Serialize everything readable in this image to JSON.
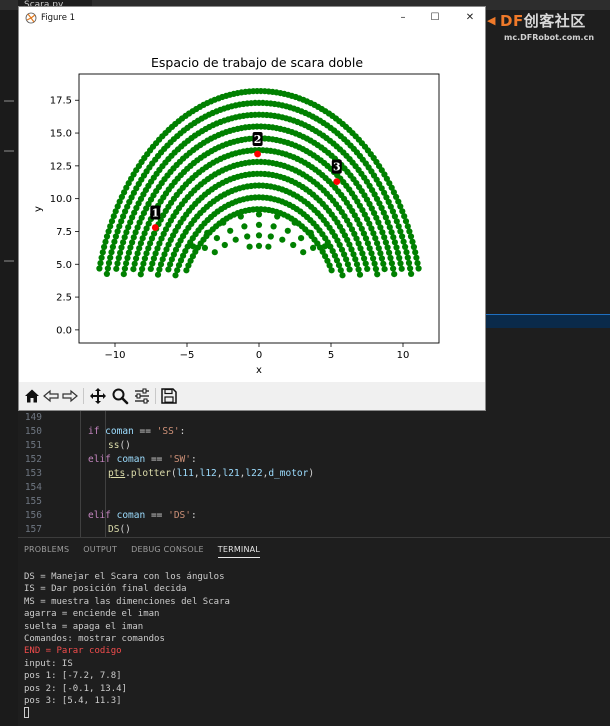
{
  "vscode": {
    "tab_label": "Scara.py",
    "code_lines": [
      {
        "n": "149",
        "tokens": []
      },
      {
        "n": "150",
        "tokens": [
          {
            "t": "if ",
            "c": "kw"
          },
          {
            "t": "coman",
            "c": "var"
          },
          {
            "t": " == ",
            "c": "op"
          },
          {
            "t": "'SS'",
            "c": "str"
          },
          {
            "t": ":",
            "c": "op"
          }
        ],
        "indent": 1
      },
      {
        "n": "151",
        "tokens": [
          {
            "t": "ss",
            "c": "fn"
          },
          {
            "t": "()",
            "c": "op"
          }
        ],
        "indent": 2
      },
      {
        "n": "152",
        "tokens": [
          {
            "t": "elif ",
            "c": "kw"
          },
          {
            "t": "coman",
            "c": "var"
          },
          {
            "t": " == ",
            "c": "op"
          },
          {
            "t": "'SW'",
            "c": "str"
          },
          {
            "t": ":",
            "c": "op"
          }
        ],
        "indent": 1
      },
      {
        "n": "153",
        "tokens": [
          {
            "t": "pts",
            "c": "fn"
          },
          {
            "t": ".",
            "c": "op"
          },
          {
            "t": "plotter",
            "c": "fn"
          },
          {
            "t": "(",
            "c": "op"
          },
          {
            "t": "l11",
            "c": "var"
          },
          {
            "t": ",",
            "c": "op"
          },
          {
            "t": "l12",
            "c": "var"
          },
          {
            "t": ",",
            "c": "op"
          },
          {
            "t": "l21",
            "c": "var"
          },
          {
            "t": ",",
            "c": "op"
          },
          {
            "t": "l22",
            "c": "var"
          },
          {
            "t": ",",
            "c": "op"
          },
          {
            "t": "d_motor",
            "c": "var"
          },
          {
            "t": ")",
            "c": "op"
          }
        ],
        "indent": 2
      },
      {
        "n": "154",
        "tokens": []
      },
      {
        "n": "155",
        "tokens": []
      },
      {
        "n": "156",
        "tokens": [
          {
            "t": "elif ",
            "c": "kw"
          },
          {
            "t": "coman",
            "c": "var"
          },
          {
            "t": " == ",
            "c": "op"
          },
          {
            "t": "'DS'",
            "c": "str"
          },
          {
            "t": ":",
            "c": "op"
          }
        ],
        "indent": 1
      },
      {
        "n": "157",
        "tokens": [
          {
            "t": "DS",
            "c": "fn"
          },
          {
            "t": "()",
            "c": "op"
          }
        ],
        "indent": 2
      }
    ],
    "panel_tabs": [
      "PROBLEMS",
      "OUTPUT",
      "DEBUG CONSOLE",
      "TERMINAL"
    ],
    "active_tab": "TERMINAL",
    "terminal_lines": [
      {
        "text": "DS = Manejar el Scara con los ángulos"
      },
      {
        "text": "IS = Dar posición final decida"
      },
      {
        "text": "MS = muestra las dimenciones del Scara"
      },
      {
        "text": "agarra = enciende el iman"
      },
      {
        "text": "suelta = apaga el iman"
      },
      {
        "text": "Comandos: mostrar comandos"
      },
      {
        "text": "END = Parar codigo",
        "red": true
      },
      {
        "text": "input: IS"
      },
      {
        "text": "pos 1: [-7.2, 7.8]"
      },
      {
        "text": "pos 2: [-0.1, 13.4]"
      },
      {
        "text": "pos 3: [5.4, 11.3]"
      }
    ]
  },
  "watermark": {
    "logo_df": "DF",
    "logo_rest": "创客社区",
    "site": "mc.DFRobot.com.cn"
  },
  "figure_window": {
    "title": "Figure 1",
    "toolbar_icons": [
      "home-icon",
      "back-icon",
      "forward-icon",
      "pan-icon",
      "zoom-icon",
      "configure-icon",
      "save-icon"
    ]
  },
  "chart_data": {
    "type": "scatter",
    "title": "Espacio de trabajo de scara doble",
    "xlabel": "x",
    "ylabel": "y",
    "xlim": [
      -12.5,
      12.5
    ],
    "ylim": [
      -1,
      19.5
    ],
    "xticks": [
      -10,
      -5,
      0,
      5,
      10
    ],
    "yticks": [
      0.0,
      2.5,
      5.0,
      7.5,
      10.0,
      12.5,
      15.0,
      17.5
    ],
    "grid": false,
    "workspace_color": "#008000",
    "workspace": {
      "outer_radius": 18.2,
      "inner_radius": 9.2,
      "center": [
        0,
        0
      ],
      "lower_boundary_y": 4.4,
      "x_extent": [
        -11.5,
        11.5
      ]
    },
    "points": [
      {
        "label": "1",
        "x": -7.2,
        "y": 7.8,
        "color": "#ff0000"
      },
      {
        "label": "2",
        "x": -0.1,
        "y": 13.4,
        "color": "#ff0000"
      },
      {
        "label": "3",
        "x": 5.4,
        "y": 11.3,
        "color": "#ff0000"
      }
    ]
  }
}
